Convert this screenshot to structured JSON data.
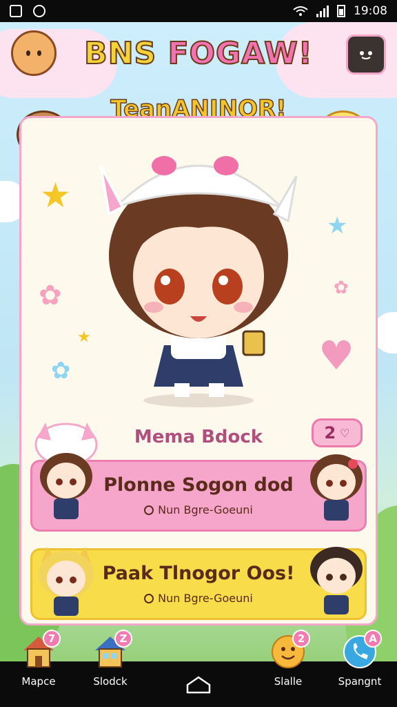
{
  "status_bar": {
    "time": "19:08"
  },
  "header": {
    "title_part1": "BNS",
    "title_part2": "FOGAW!",
    "subtitle": "TeanANINOR!"
  },
  "main": {
    "caption": "Mema Bdock",
    "badge_count": "2"
  },
  "banners": [
    {
      "title": "Plonne Sogon dod",
      "subtitle": "Nun Bgre-Goeuni"
    },
    {
      "title": "Paak Tlnogor Oos!",
      "subtitle": "Nun Bgre-Goeuni"
    }
  ],
  "bottom_nav": [
    {
      "label": "Mapce",
      "badge": "7"
    },
    {
      "label": "Slodck",
      "badge": "Z"
    },
    {
      "label": "Slalle",
      "badge": "2"
    },
    {
      "label": "Spangnt",
      "badge": "A"
    }
  ],
  "colors": {
    "card_border": "#f3a8c9",
    "pink_banner": "#f6a6ca",
    "yellow_banner": "#f8dc4a",
    "title_yellow": "#f3d33a",
    "title_pink": "#f273b1"
  }
}
